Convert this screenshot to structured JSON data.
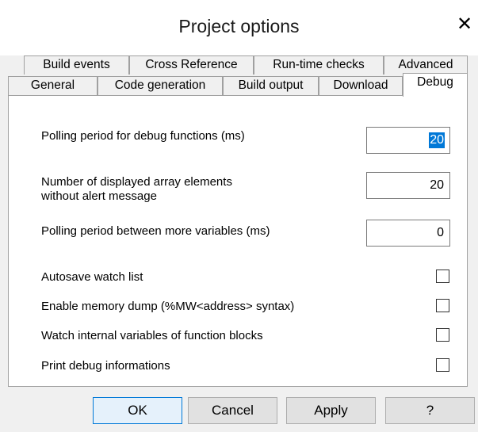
{
  "window": {
    "title": "Project options",
    "close_glyph": "✕"
  },
  "tabs_row1": [
    "Build events",
    "Cross Reference",
    "Run-time checks",
    "Advanced"
  ],
  "tabs_row2": [
    "General",
    "Code generation",
    "Build output",
    "Download",
    "Debug"
  ],
  "active_tab": "Debug",
  "fields": {
    "polling_debug": {
      "label": "Polling period for debug functions (ms)",
      "value": "20",
      "selected": true
    },
    "array_elements": {
      "label_line1": "Number of displayed array elements",
      "label_line2": "without alert message",
      "value": "20"
    },
    "polling_vars": {
      "label": "Polling period between more variables (ms)",
      "value": "0"
    }
  },
  "checkboxes": [
    {
      "label": "Autosave watch list",
      "checked": false
    },
    {
      "label": "Enable memory dump  (%MW<address> syntax)",
      "checked": false
    },
    {
      "label": "Watch internal variables of function blocks",
      "checked": false
    },
    {
      "label": "Print debug informations",
      "checked": false
    }
  ],
  "buttons": {
    "ok": "OK",
    "cancel": "Cancel",
    "apply": "Apply",
    "help": "?"
  }
}
